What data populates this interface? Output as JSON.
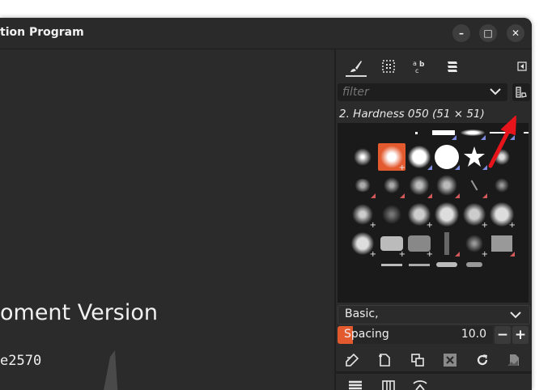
{
  "window": {
    "title": "tion Program",
    "buttons": {
      "minimize": "–",
      "maximize": "□",
      "close": "✕"
    }
  },
  "canvas": {
    "splash_title": "oment Version",
    "splash_hash": "e2570"
  },
  "dock": {
    "tabs": [
      {
        "name": "brushes",
        "icon": "paintbrush-icon"
      },
      {
        "name": "patterns",
        "icon": "pattern-grid-icon"
      },
      {
        "name": "fonts",
        "icon": "text-abc-icon"
      },
      {
        "name": "layers-stack",
        "icon": "stack-icon"
      }
    ],
    "filter": {
      "placeholder": "filter",
      "value": ""
    },
    "selected_brush": "2. Hardness 050 (51 × 51)",
    "preset": "Basic,",
    "spacing": {
      "label": "Spacing",
      "value": "10.0",
      "fill_fraction": 0.1
    },
    "steppers": {
      "minus": "−",
      "plus": "+"
    },
    "actions": [
      "edit-brush-icon",
      "new-brush-icon",
      "duplicate-brush-icon",
      "delete-brush-icon",
      "refresh-icon",
      "open-as-image-icon"
    ],
    "bottom_tabs": [
      "layers-icon",
      "channels-icon",
      "paths-icon"
    ]
  },
  "colors": {
    "accent": "#e35a2f",
    "panel_bg": "#2b2b2b",
    "grid_bg": "#1a1a1a",
    "arrow": "#e8141c"
  }
}
